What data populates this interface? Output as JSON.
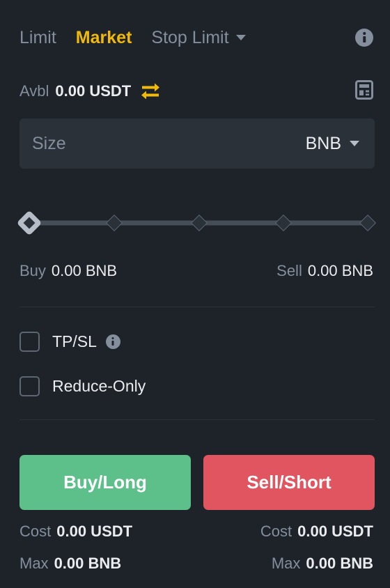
{
  "order_tabs": [
    {
      "label": "Limit",
      "active": false,
      "has_caret": false
    },
    {
      "label": "Market",
      "active": true,
      "has_caret": false
    },
    {
      "label": "Stop Limit",
      "active": false,
      "has_caret": true
    }
  ],
  "header": {
    "info_icon": "info-icon"
  },
  "balance": {
    "label": "Avbl",
    "value": "0.00 USDT",
    "transfer_icon": "transfer-icon",
    "calculator_icon": "calculator-icon"
  },
  "size_input": {
    "placeholder": "Size",
    "value": "",
    "unit": "BNB",
    "caret_icon": "chevron-down-icon"
  },
  "slider": {
    "value_percent": 0,
    "ticks": [
      0,
      25,
      50,
      75,
      100
    ]
  },
  "quantity": {
    "buy_label": "Buy",
    "buy_value": "0.00 BNB",
    "sell_label": "Sell",
    "sell_value": "0.00 BNB"
  },
  "options": {
    "tpsl_label": "TP/SL",
    "tpsl_checked": false,
    "tpsl_info_icon": "info-icon",
    "reduce_only_label": "Reduce-Only",
    "reduce_only_checked": false
  },
  "actions": {
    "buy_label": "Buy/Long",
    "sell_label": "Sell/Short",
    "buy_color": "#5dc08a",
    "sell_color": "#e0555f"
  },
  "footer": {
    "buy_cost_label": "Cost",
    "buy_cost_value": "0.00 USDT",
    "sell_cost_label": "Cost",
    "sell_cost_value": "0.00 USDT",
    "buy_max_label": "Max",
    "buy_max_value": "0.00 BNB",
    "sell_max_label": "Max",
    "sell_max_value": "0.00 BNB"
  },
  "colors": {
    "background": "#1e2329",
    "field_background": "#2b3139",
    "accent_yellow": "#f0b90b",
    "muted_text": "#848e9c",
    "primary_text": "#eaecef"
  }
}
